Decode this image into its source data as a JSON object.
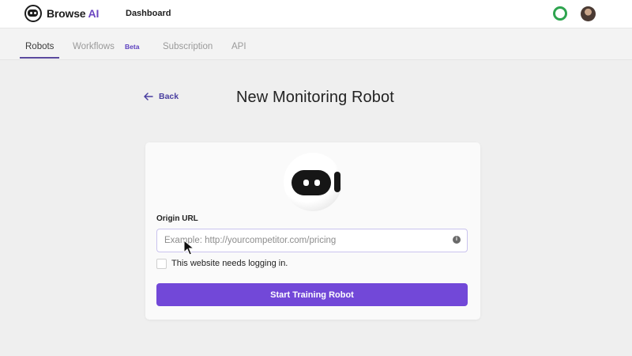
{
  "header": {
    "logo_word": "Browse",
    "logo_accent": "AI",
    "nav_dashboard": "Dashboard",
    "status_color": "#2ea44f"
  },
  "tabs": [
    {
      "label": "Robots",
      "active": true
    },
    {
      "label": "Workflows",
      "badge": "Beta"
    },
    {
      "label": "Subscription"
    },
    {
      "label": "API"
    }
  ],
  "page": {
    "back_label": "Back",
    "title": "New Monitoring Robot"
  },
  "form": {
    "origin_label": "Origin URL",
    "url_placeholder": "Example: http://yourcompetitor.com/pricing",
    "url_value": "",
    "login_checkbox_label": "This website needs logging in.",
    "login_checked": false,
    "submit_label": "Start Training Robot"
  },
  "colors": {
    "accent": "#7248d8",
    "link": "#4a3fa0"
  },
  "icons": [
    "browse-ai-logo-icon",
    "status-ring-icon",
    "user-avatar",
    "arrow-left-icon",
    "robot-mascot-icon",
    "info-icon",
    "mouse-pointer-icon"
  ]
}
